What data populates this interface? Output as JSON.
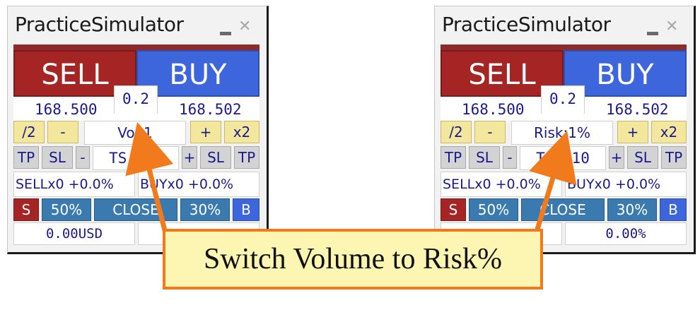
{
  "panels": [
    {
      "title": "PracticeSimulator",
      "sell_label": "SELL",
      "buy_label": "BUY",
      "spread": "0.2",
      "sell_price": "168.500",
      "buy_price": "168.502",
      "half_label": "/2",
      "minus_label": "-",
      "volume_field": "Vol:1",
      "plus_label": "+",
      "double_label": "x2",
      "tp_label": "TP",
      "sl_label": "SL",
      "ts_minus_label": "-",
      "ts_field": "TS: 10",
      "ts_plus_label": "+",
      "sl2_label": "SL",
      "tp2_label": "TP",
      "sell_positions": "SELLx0 +0.0%",
      "buy_positions": "BUYx0 +0.0%",
      "close_s_label": "S",
      "close_50_label": "50%",
      "close_all_label": "CLOSE",
      "close_30_label": "30%",
      "close_b_label": "B",
      "pl_value": "0.00USD",
      "pl_right": ""
    },
    {
      "title": "PracticeSimulator",
      "sell_label": "SELL",
      "buy_label": "BUY",
      "spread": "0.2",
      "sell_price": "168.500",
      "buy_price": "168.502",
      "half_label": "/2",
      "minus_label": "-",
      "volume_field": "Risk:1%",
      "plus_label": "+",
      "double_label": "x2",
      "tp_label": "TP",
      "sl_label": "SL",
      "ts_minus_label": "-",
      "ts_field": "TS: 10",
      "ts_plus_label": "+",
      "sl2_label": "SL",
      "tp2_label": "TP",
      "sell_positions": "SELLx0 +0.0%",
      "buy_positions": "BUYx0 +0.0%",
      "close_s_label": "S",
      "close_50_label": "50%",
      "close_all_label": "CLOSE",
      "close_30_label": "30%",
      "close_b_label": "B",
      "pl_value": "",
      "pl_right": "0.00%"
    }
  ],
  "callout": {
    "text": "Switch Volume to Risk%"
  },
  "colors": {
    "sell": "#a52424",
    "buy": "#3d66dc",
    "accent_arrow": "#f07a1c",
    "callout_bg": "#fdf5b2",
    "yellow_button": "#f3e79d",
    "teal_button": "#3a7aae"
  },
  "icons": {
    "minimize": "minimize-icon",
    "close": "close-icon"
  }
}
